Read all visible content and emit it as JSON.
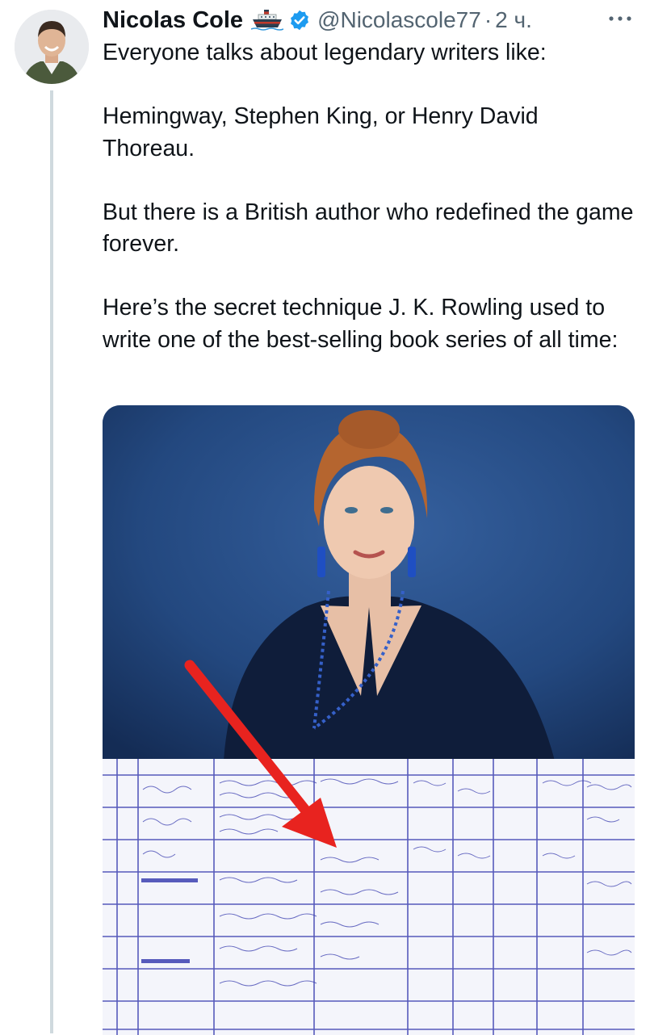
{
  "tweet": {
    "author_name": "Nicolas Cole",
    "handle": "@Nicolascole77",
    "separator": "·",
    "time": "2 ч.",
    "paragraphs": [
      "Everyone talks about legendary writers like:",
      "Hemingway, Stephen King, or Henry David Thoreau.",
      "But there is a British author who redefined the game forever.",
      "Here’s the secret technique J. K. Rowling used to write one of the best-selling book series of all time:"
    ]
  },
  "icons": {
    "author_badge": "ship-icon",
    "verified": "verified-badge-icon",
    "more": "more-options-icon"
  },
  "colors": {
    "verified_blue": "#1d9bf0",
    "secondary_text": "#536471",
    "arrow_red": "#e8231f",
    "grid_ink": "#3b3fb0",
    "photo_background": "#1f3f73"
  }
}
